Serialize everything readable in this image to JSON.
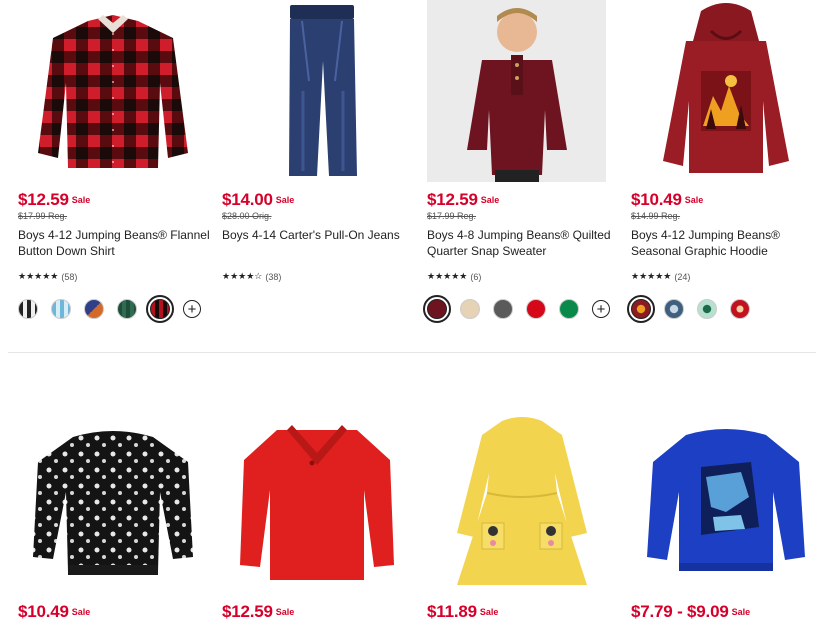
{
  "products_row1": [
    {
      "price": "$12.59",
      "sale_label": "Sale",
      "regular": "$17.99 Reg.",
      "title": "Boys 4-12 Jumping Beans® Flannel Button Down Shirt",
      "stars": "★★★★★",
      "review_count": "(58)",
      "swatches": [
        {
          "name": "black-white-plaid",
          "color": "#2a2a2a"
        },
        {
          "name": "blue-plaid",
          "color": "#6fb6d9"
        },
        {
          "name": "navy-orange-plaid",
          "color": "#4a4a8a"
        },
        {
          "name": "green-plaid",
          "color": "#1e4d3a"
        },
        {
          "name": "red-buffalo-check",
          "color": "#b3121f"
        }
      ],
      "selected_swatch": 4,
      "has_more_colors": true
    },
    {
      "price": "$14.00",
      "sale_label": "Sale",
      "regular": "$28.00 Orig.",
      "title": "Boys 4-14 Carter's Pull-On Jeans",
      "stars": "★★★★☆",
      "review_count": "(38)",
      "swatches": [],
      "has_more_colors": false
    },
    {
      "price": "$12.59",
      "sale_label": "Sale",
      "regular": "$17.99 Reg.",
      "title": "Boys 4-8 Jumping Beans® Quilted Quarter Snap Sweater",
      "stars": "★★★★★",
      "review_count": "(6)",
      "swatches": [
        {
          "name": "burgundy",
          "color": "#6e1420"
        },
        {
          "name": "oatmeal",
          "color": "#e6d2b5"
        },
        {
          "name": "charcoal",
          "color": "#5a5a5a"
        },
        {
          "name": "red",
          "color": "#d5081a"
        },
        {
          "name": "green",
          "color": "#0a8a4a"
        }
      ],
      "selected_swatch": 0,
      "has_more_colors": true
    },
    {
      "price": "$10.49",
      "sale_label": "Sale",
      "regular": "$14.99 Reg.",
      "title": "Boys 4-12 Jumping Beans® Seasonal Graphic Hoodie",
      "stars": "★★★★★",
      "review_count": "(24)",
      "swatches": [
        {
          "name": "maroon-graphic",
          "color": "#8a1c22"
        },
        {
          "name": "blue-graphic",
          "color": "#3f5f7f"
        },
        {
          "name": "teal-graphic",
          "color": "#4aa38a"
        },
        {
          "name": "red-graphic",
          "color": "#c2121f"
        }
      ],
      "selected_swatch": 0,
      "has_more_colors": false
    }
  ],
  "products_row2": [
    {
      "price": "$10.49",
      "sale_label": "Sale"
    },
    {
      "price": "$12.59",
      "sale_label": "Sale"
    },
    {
      "price": "$11.89",
      "sale_label": "Sale"
    },
    {
      "price": "$7.79 - $9.09",
      "sale_label": "Sale"
    }
  ],
  "colors": {
    "sale_red": "#d6002a"
  }
}
